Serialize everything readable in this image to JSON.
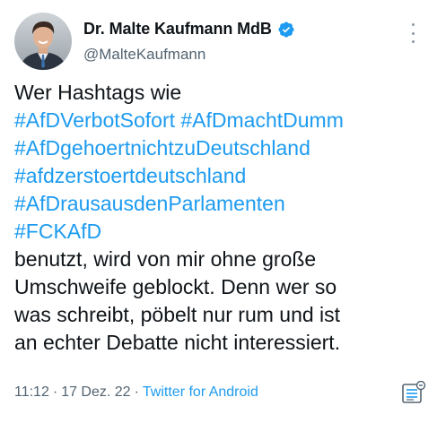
{
  "author": {
    "display_name": "Dr. Malte Kaufmann MdB",
    "handle": "@MalteKaufmann",
    "verified": true,
    "verified_icon": "verified-badge-icon"
  },
  "tweet": {
    "intro": "Wer Hashtags wie",
    "hashtags": [
      "#AfDVerbotSofort",
      "#AfDmachtDumm",
      "#AfDgehoertnichtzuDeutschland",
      "#afdzerstoertdeutschland",
      "#AfDrausausdenParlamenten",
      "#FCKAfD"
    ],
    "lines": [
      "benutzt, wird von mir ohne große",
      "Umschweife geblockt. Denn wer so",
      "was schreibt, pöbelt nur rum und ist",
      "an echter Debatte nicht interessiert."
    ]
  },
  "meta": {
    "time": "11:12",
    "separator": "·",
    "date": "17 Dez. 22",
    "source": "Twitter for Android"
  },
  "icons": {
    "more": "more-options-icon",
    "analytics": "tweet-analytics-icon"
  },
  "colors": {
    "link": "#1d9bf0",
    "text": "#0f1419",
    "secondary": "#536471"
  }
}
